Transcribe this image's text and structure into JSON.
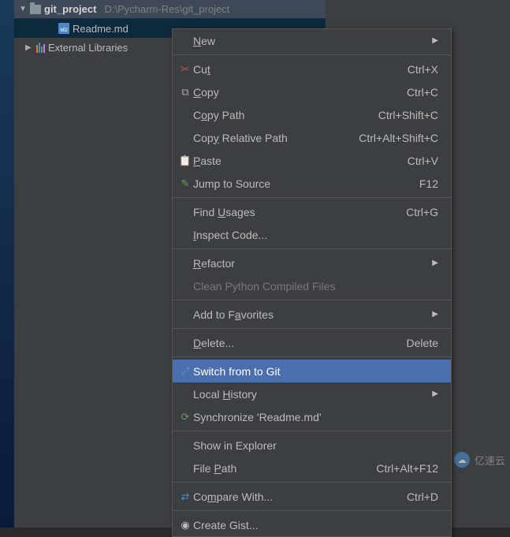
{
  "tree": {
    "project_name": "git_project",
    "project_path": "D:\\Pycharm-Res\\git_project",
    "file_name": "Readme.md",
    "external_libraries": "External Libraries"
  },
  "menu": {
    "new": "New",
    "cut": "Cut",
    "cut_key": "Ctrl+X",
    "copy": "Copy",
    "copy_key": "Ctrl+C",
    "copy_path": "Copy Path",
    "copy_path_key": "Ctrl+Shift+C",
    "copy_rel_path": "Copy Relative Path",
    "copy_rel_path_key": "Ctrl+Alt+Shift+C",
    "paste": "Paste",
    "paste_key": "Ctrl+V",
    "jump_to_source": "Jump to Source",
    "jump_to_source_key": "F12",
    "find_usages": "Find Usages",
    "find_usages_key": "Ctrl+G",
    "inspect_code": "Inspect Code...",
    "refactor": "Refactor",
    "clean_pyc": "Clean Python Compiled Files",
    "add_to_favorites": "Add to Favorites",
    "delete": "Delete...",
    "delete_key": "Delete",
    "switch_git": "Switch from  to Git",
    "local_history": "Local History",
    "synchronize": "Synchronize 'Readme.md'",
    "show_in_explorer": "Show in Explorer",
    "file_path": "File Path",
    "file_path_key": "Ctrl+Alt+F12",
    "compare_with": "Compare With...",
    "compare_with_key": "Ctrl+D",
    "create_gist": "Create Gist..."
  },
  "watermark": "亿速云"
}
